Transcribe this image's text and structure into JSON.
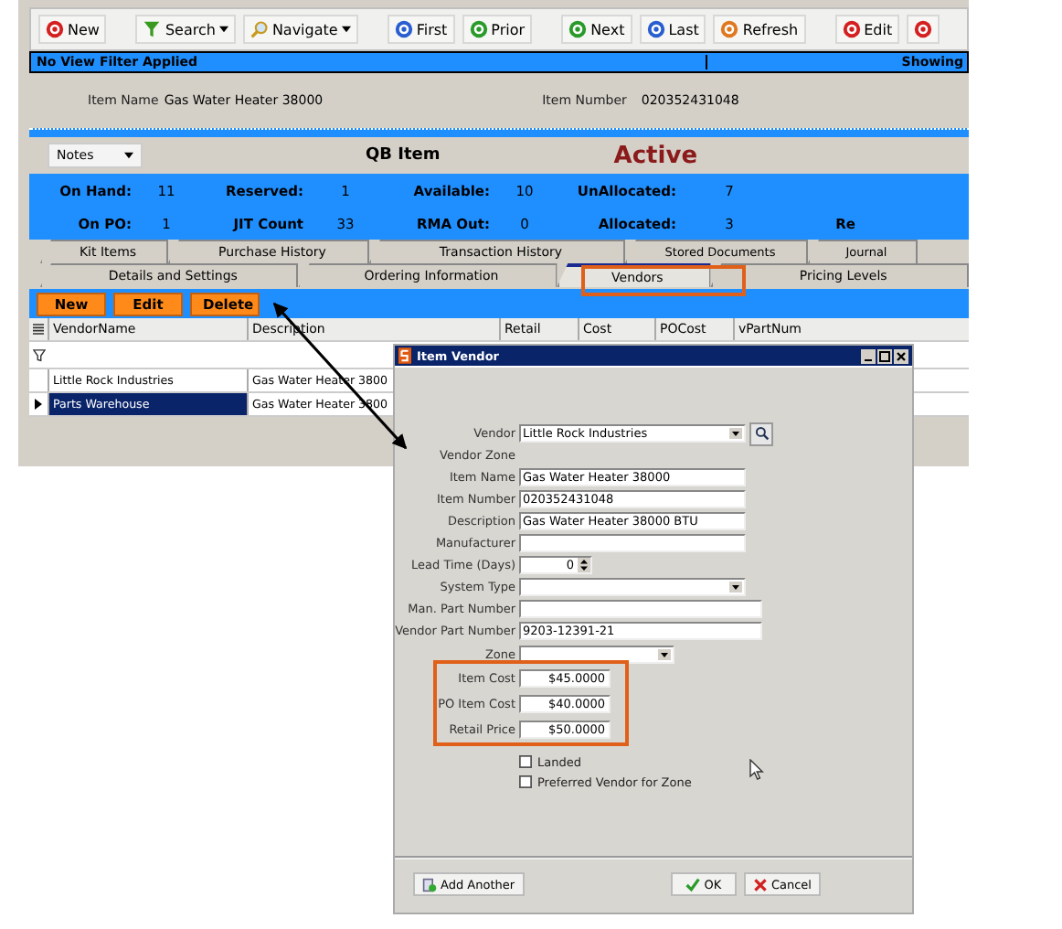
{
  "toolbar": [
    {
      "label": "New",
      "kind": "round",
      "color": "#d42020",
      "dropdown": false
    },
    {
      "label": "Search",
      "kind": "funnel",
      "color": "#3a9a20",
      "dropdown": true
    },
    {
      "label": "Navigate",
      "kind": "magnifier",
      "color": "#c89a20",
      "dropdown": true
    },
    {
      "label": "First",
      "kind": "round",
      "color": "#2a5ed0",
      "dropdown": false
    },
    {
      "label": "Prior",
      "kind": "round",
      "color": "#2a9a2a",
      "dropdown": false
    },
    {
      "label": "Next",
      "kind": "round",
      "color": "#2a9a2a",
      "dropdown": false
    },
    {
      "label": "Last",
      "kind": "round",
      "color": "#2a5ed0",
      "dropdown": false
    },
    {
      "label": "Refresh",
      "kind": "round",
      "color": "#e07820",
      "dropdown": false
    },
    {
      "label": "Edit",
      "kind": "round",
      "color": "#d42020",
      "dropdown": false
    },
    {
      "kind": "round",
      "color": "#d42020",
      "dropdown": false
    }
  ],
  "filter_bar": {
    "text": "No View Filter Applied",
    "right": "Showing"
  },
  "item": {
    "name_label": "Item Name",
    "name": "Gas Water Heater 38000",
    "number_label": "Item Number",
    "number": "020352431048"
  },
  "notes_button": "Notes",
  "qb_label": "QB Item",
  "status": "Active",
  "stats": [
    [
      {
        "label": "On Hand:",
        "value": "11"
      },
      {
        "label": "Reserved:",
        "value": "1"
      },
      {
        "label": "Available:",
        "value": "10"
      },
      {
        "label": "UnAllocated:",
        "value": "7"
      }
    ],
    [
      {
        "label": "On PO:",
        "value": "1"
      },
      {
        "label": "JIT Count",
        "value": "33"
      },
      {
        "label": "RMA Out:",
        "value": "0"
      },
      {
        "label": "Allocated:",
        "value": "3"
      },
      {
        "label": "Re"
      }
    ]
  ],
  "tabs_back": [
    {
      "label": "Kit Items",
      "selected": false
    },
    {
      "label": "Purchase History",
      "selected": false
    },
    {
      "label": "Transaction History",
      "selected": false
    },
    {
      "label": "Stored Documents",
      "selected": false
    },
    {
      "label": "Journal",
      "selected": false
    }
  ],
  "tabs_front": [
    {
      "label": "Details and Settings",
      "selected": false
    },
    {
      "label": "Ordering Information",
      "selected": false
    },
    {
      "label": "Vendors",
      "selected": true
    },
    {
      "label": "Pricing Levels",
      "selected": false
    }
  ],
  "actions": [
    "New",
    "Edit",
    "Delete"
  ],
  "table": {
    "columns": [
      "VendorName",
      "Description",
      "Retail",
      "Cost",
      "POCost",
      "vPartNum"
    ],
    "rows": [
      {
        "cells": [
          "Little Rock Industries",
          "Gas Water Heater 3800"
        ],
        "selected": false
      },
      {
        "cells": [
          "Parts Warehouse",
          "Gas Water Heater 3800"
        ],
        "selected": true
      }
    ]
  },
  "dialog": {
    "title": "Item Vendor",
    "fields": [
      {
        "kind": "combo-search",
        "label": "Vendor",
        "value": "Little Rock Industries"
      },
      {
        "kind": "label",
        "label": "Vendor Zone"
      },
      {
        "kind": "text",
        "label": "Item Name",
        "value": "Gas Water Heater 38000"
      },
      {
        "kind": "text",
        "label": "Item Number",
        "value": "020352431048"
      },
      {
        "kind": "text",
        "label": "Description",
        "value": "Gas Water Heater 38000 BTU"
      },
      {
        "kind": "text",
        "label": "Manufacturer"
      },
      {
        "kind": "spinner",
        "label": "Lead Time (Days)",
        "value": "0"
      },
      {
        "kind": "combo",
        "label": "System Type"
      },
      {
        "kind": "wide",
        "label": "Man. Part Number"
      },
      {
        "kind": "wide",
        "label": "Vendor Part Number",
        "value": "9203-12391-21"
      },
      {
        "kind": "combo-short",
        "label": "Zone"
      },
      {
        "kind": "money",
        "label": "Item Cost",
        "value": "$45.0000"
      },
      {
        "kind": "money",
        "label": "PO Item Cost",
        "value": "$40.0000"
      },
      {
        "kind": "money",
        "label": "Retail Price",
        "value": "$50.0000"
      },
      {
        "kind": "checkbox",
        "label": "Landed",
        "checked": false
      },
      {
        "kind": "checkbox",
        "label": "Preferred Vendor for Zone",
        "checked": false
      }
    ],
    "buttons": [
      {
        "label": "Add Another",
        "kind": "add"
      },
      {
        "label": "OK",
        "kind": "ok"
      },
      {
        "label": "Cancel",
        "kind": "cancel"
      }
    ]
  }
}
